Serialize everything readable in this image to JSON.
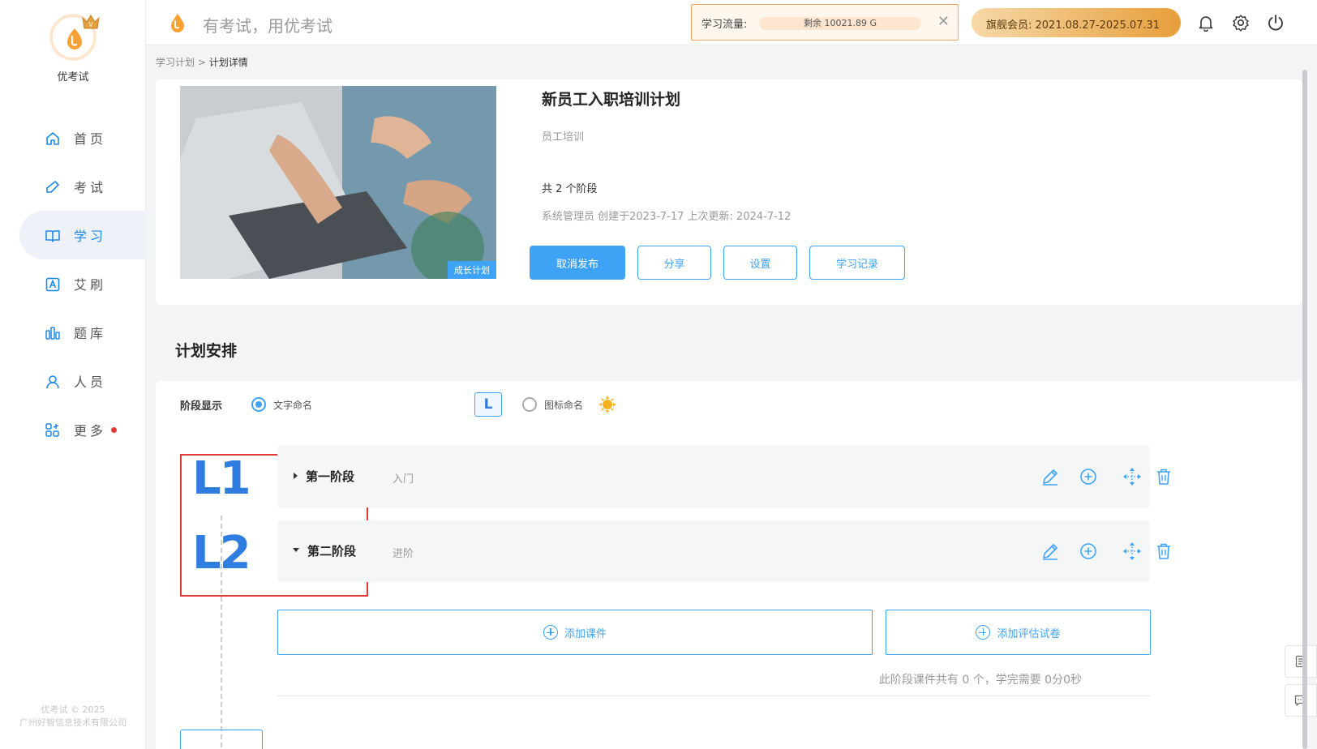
{
  "brand": {
    "name": "优考试",
    "slogan": "有考试，用优考试"
  },
  "sidebar": {
    "items": [
      {
        "label": "首页",
        "icon": "home-icon"
      },
      {
        "label": "考试",
        "icon": "exam-icon"
      },
      {
        "label": "学习",
        "icon": "book-icon",
        "active": true
      },
      {
        "label": "艾刷",
        "icon": "practice-icon"
      },
      {
        "label": "题库",
        "icon": "question-bank-icon"
      },
      {
        "label": "人员",
        "icon": "user-icon"
      },
      {
        "label": "更多",
        "icon": "more-icon",
        "dot": true
      }
    ],
    "copyright_line1": "优考试 © 2025",
    "copyright_line2": "广州好智信息技术有限公司"
  },
  "topbar": {
    "flow_label": "学习流量:",
    "flow_remaining": "剩余 10021.89 G",
    "vip_text": "旗舰会员: 2021.08.27-2025.07.31"
  },
  "breadcrumb": {
    "parent": "学习计划",
    "separator": ">",
    "current": "计划详情"
  },
  "plan": {
    "cover_tag": "成长计划",
    "title": "新员工入职培训计划",
    "category": "员工培训",
    "stage_count": "共 2 个阶段",
    "meta": "系统管理员 创建于2023-7-17 上次更新: 2024-7-12",
    "buttons": {
      "unpublish": "取消发布",
      "share": "分享",
      "settings": "设置",
      "records": "学习记录"
    }
  },
  "schedule": {
    "title": "计划安排",
    "display_label": "阶段显示",
    "option_text": "文字命名",
    "option_text_badge": "L",
    "option_icon": "图标命名",
    "stages": [
      {
        "badge": "L1",
        "name": "第一阶段",
        "desc": "入门",
        "expanded": false
      },
      {
        "badge": "L2",
        "name": "第二阶段",
        "desc": "进阶",
        "expanded": true
      }
    ],
    "add_course": "添加课件",
    "add_paper": "添加评估试卷",
    "summary": "此阶段课件共有 0 个，学完需要 0分0秒"
  },
  "colors": {
    "accent": "#3fa3f5",
    "badge_blue": "#2f7de1",
    "highlight_red": "#e53935",
    "vip_gold": "#e79e3b"
  }
}
